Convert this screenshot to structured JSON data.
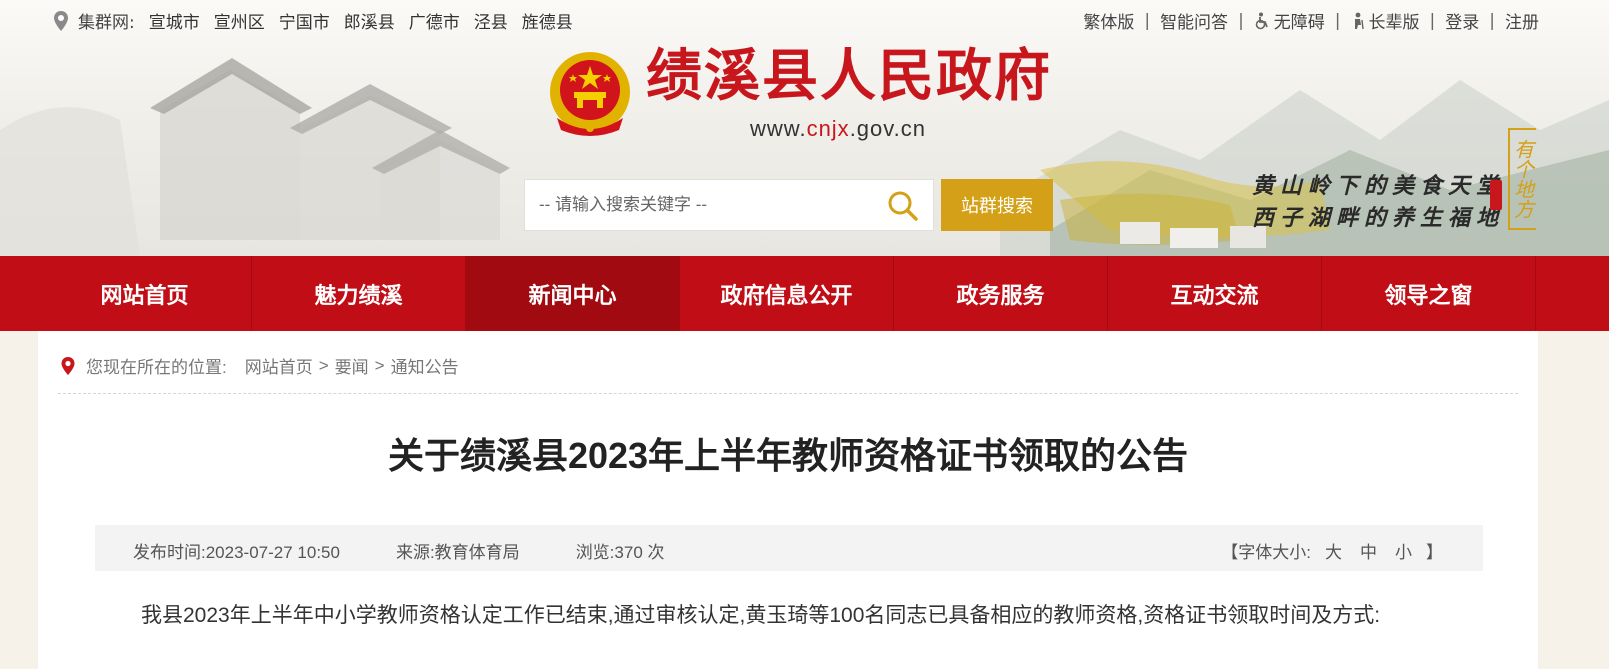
{
  "topbar": {
    "cluster_label": "集群网:",
    "cluster_links": [
      "宣城市",
      "宣州区",
      "宁国市",
      "郎溪县",
      "广德市",
      "泾县",
      "旌德县"
    ],
    "right_links": [
      {
        "label": "繁体版",
        "icon": ""
      },
      {
        "label": "智能问答",
        "icon": ""
      },
      {
        "label": "无障碍",
        "icon": "wheelchair-icon"
      },
      {
        "label": "长辈版",
        "icon": "elder-icon"
      },
      {
        "label": "登录",
        "icon": ""
      },
      {
        "label": "注册",
        "icon": ""
      }
    ]
  },
  "header": {
    "title": "绩溪县人民政府",
    "url_prefix": "www.",
    "url_highlight": "cnjx",
    "url_suffix": ".gov.cn",
    "search_placeholder": "-- 请输入搜索关键字 --",
    "search_button": "站群搜索",
    "slogan_line1": "黄山岭下的美食天堂",
    "slogan_line2": "西子湖畔的养生福地",
    "vertical_tag": "有个地方"
  },
  "nav": {
    "items": [
      "网站首页",
      "魅力绩溪",
      "新闻中心",
      "政府信息公开",
      "政务服务",
      "互动交流",
      "领导之窗"
    ],
    "active_index": 2
  },
  "breadcrumb": {
    "label": "您现在所在的位置:",
    "items": [
      "网站首页",
      "要闻",
      "通知公告"
    ],
    "separator": ">"
  },
  "article": {
    "title": "关于绩溪县2023年上半年教师资格证书领取的公告",
    "publish_time": "发布时间:2023-07-27 10:50",
    "source": "来源:教育体育局",
    "views": "浏览:370 次",
    "font_size_open": "【字体大小:",
    "font_size_options": [
      "大",
      "中",
      "小"
    ],
    "font_size_close": "】",
    "body": "我县2023年上半年中小学教师资格认定工作已结束,通过审核认定,黄玉琦等100名同志已具备相应的教师资格,资格证书领取时间及方式:"
  },
  "colors": {
    "brand_red": "#c10d15",
    "nav_active": "#a00a10",
    "gold": "#d4a017",
    "title_red": "#c8161d"
  }
}
